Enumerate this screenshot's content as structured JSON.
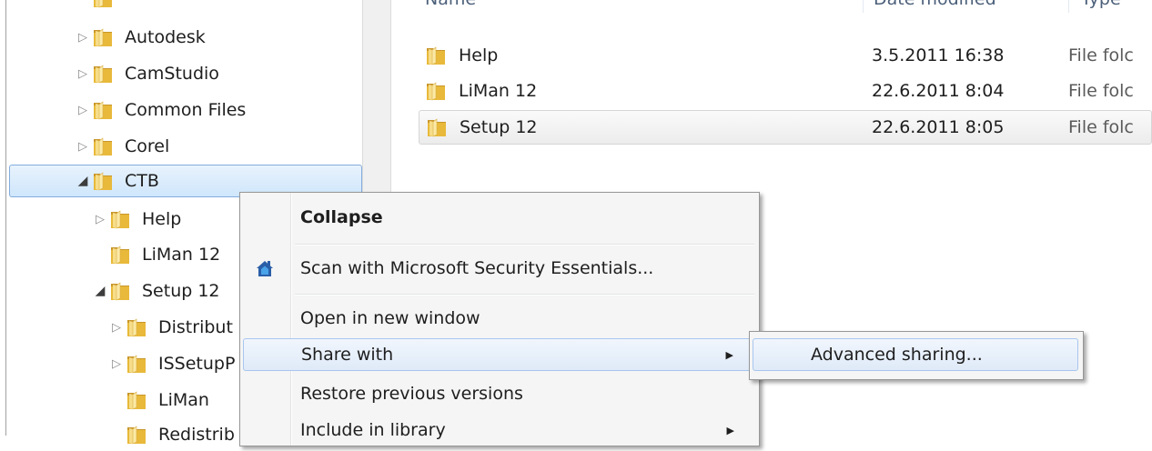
{
  "tree": {
    "items": [
      {
        "label": "Autodesk",
        "expanded": false,
        "level": 0
      },
      {
        "label": "CamStudio",
        "expanded": false,
        "level": 0
      },
      {
        "label": "Common Files",
        "expanded": false,
        "level": 0
      },
      {
        "label": "Corel",
        "expanded": false,
        "level": 0
      },
      {
        "label": "CTB",
        "expanded": true,
        "level": 0,
        "selected": true
      },
      {
        "label": "Help",
        "expanded": false,
        "level": 1
      },
      {
        "label": "LiMan 12",
        "expanded": null,
        "level": 1
      },
      {
        "label": "Setup 12",
        "expanded": true,
        "level": 1
      },
      {
        "label": "Distribut",
        "expanded": false,
        "level": 2
      },
      {
        "label": "ISSetupP",
        "expanded": false,
        "level": 2
      },
      {
        "label": "LiMan",
        "expanded": null,
        "level": 2
      },
      {
        "label": "Redistrib",
        "expanded": null,
        "level": 2
      }
    ]
  },
  "file_list": {
    "columns": [
      "Name",
      "Date modified",
      "Type"
    ],
    "rows": [
      {
        "name": "Help",
        "date": "3.5.2011 16:38",
        "type": "File folc"
      },
      {
        "name": "LiMan 12",
        "date": "22.6.2011 8:04",
        "type": "File folc"
      },
      {
        "name": "Setup 12",
        "date": "22.6.2011 8:05",
        "type": "File folc"
      }
    ]
  },
  "context_menu": {
    "items": [
      {
        "label": "Collapse",
        "bold": true
      },
      {
        "label": "Scan with Microsoft Security Essentials...",
        "icon": "security-essentials-icon"
      },
      {
        "label": "Open in new window"
      },
      {
        "label": "Share with",
        "submenu": true,
        "highlighted": true
      },
      {
        "label": "Restore previous versions"
      },
      {
        "label": "Include in library",
        "submenu": true
      }
    ],
    "submenu": {
      "items": [
        {
          "label": "Advanced sharing...",
          "highlighted": true
        }
      ]
    }
  },
  "colors": {
    "folder": "#e8b93a",
    "selection": "#cfe6fb",
    "menu_highlight": "#dfeaf8"
  }
}
